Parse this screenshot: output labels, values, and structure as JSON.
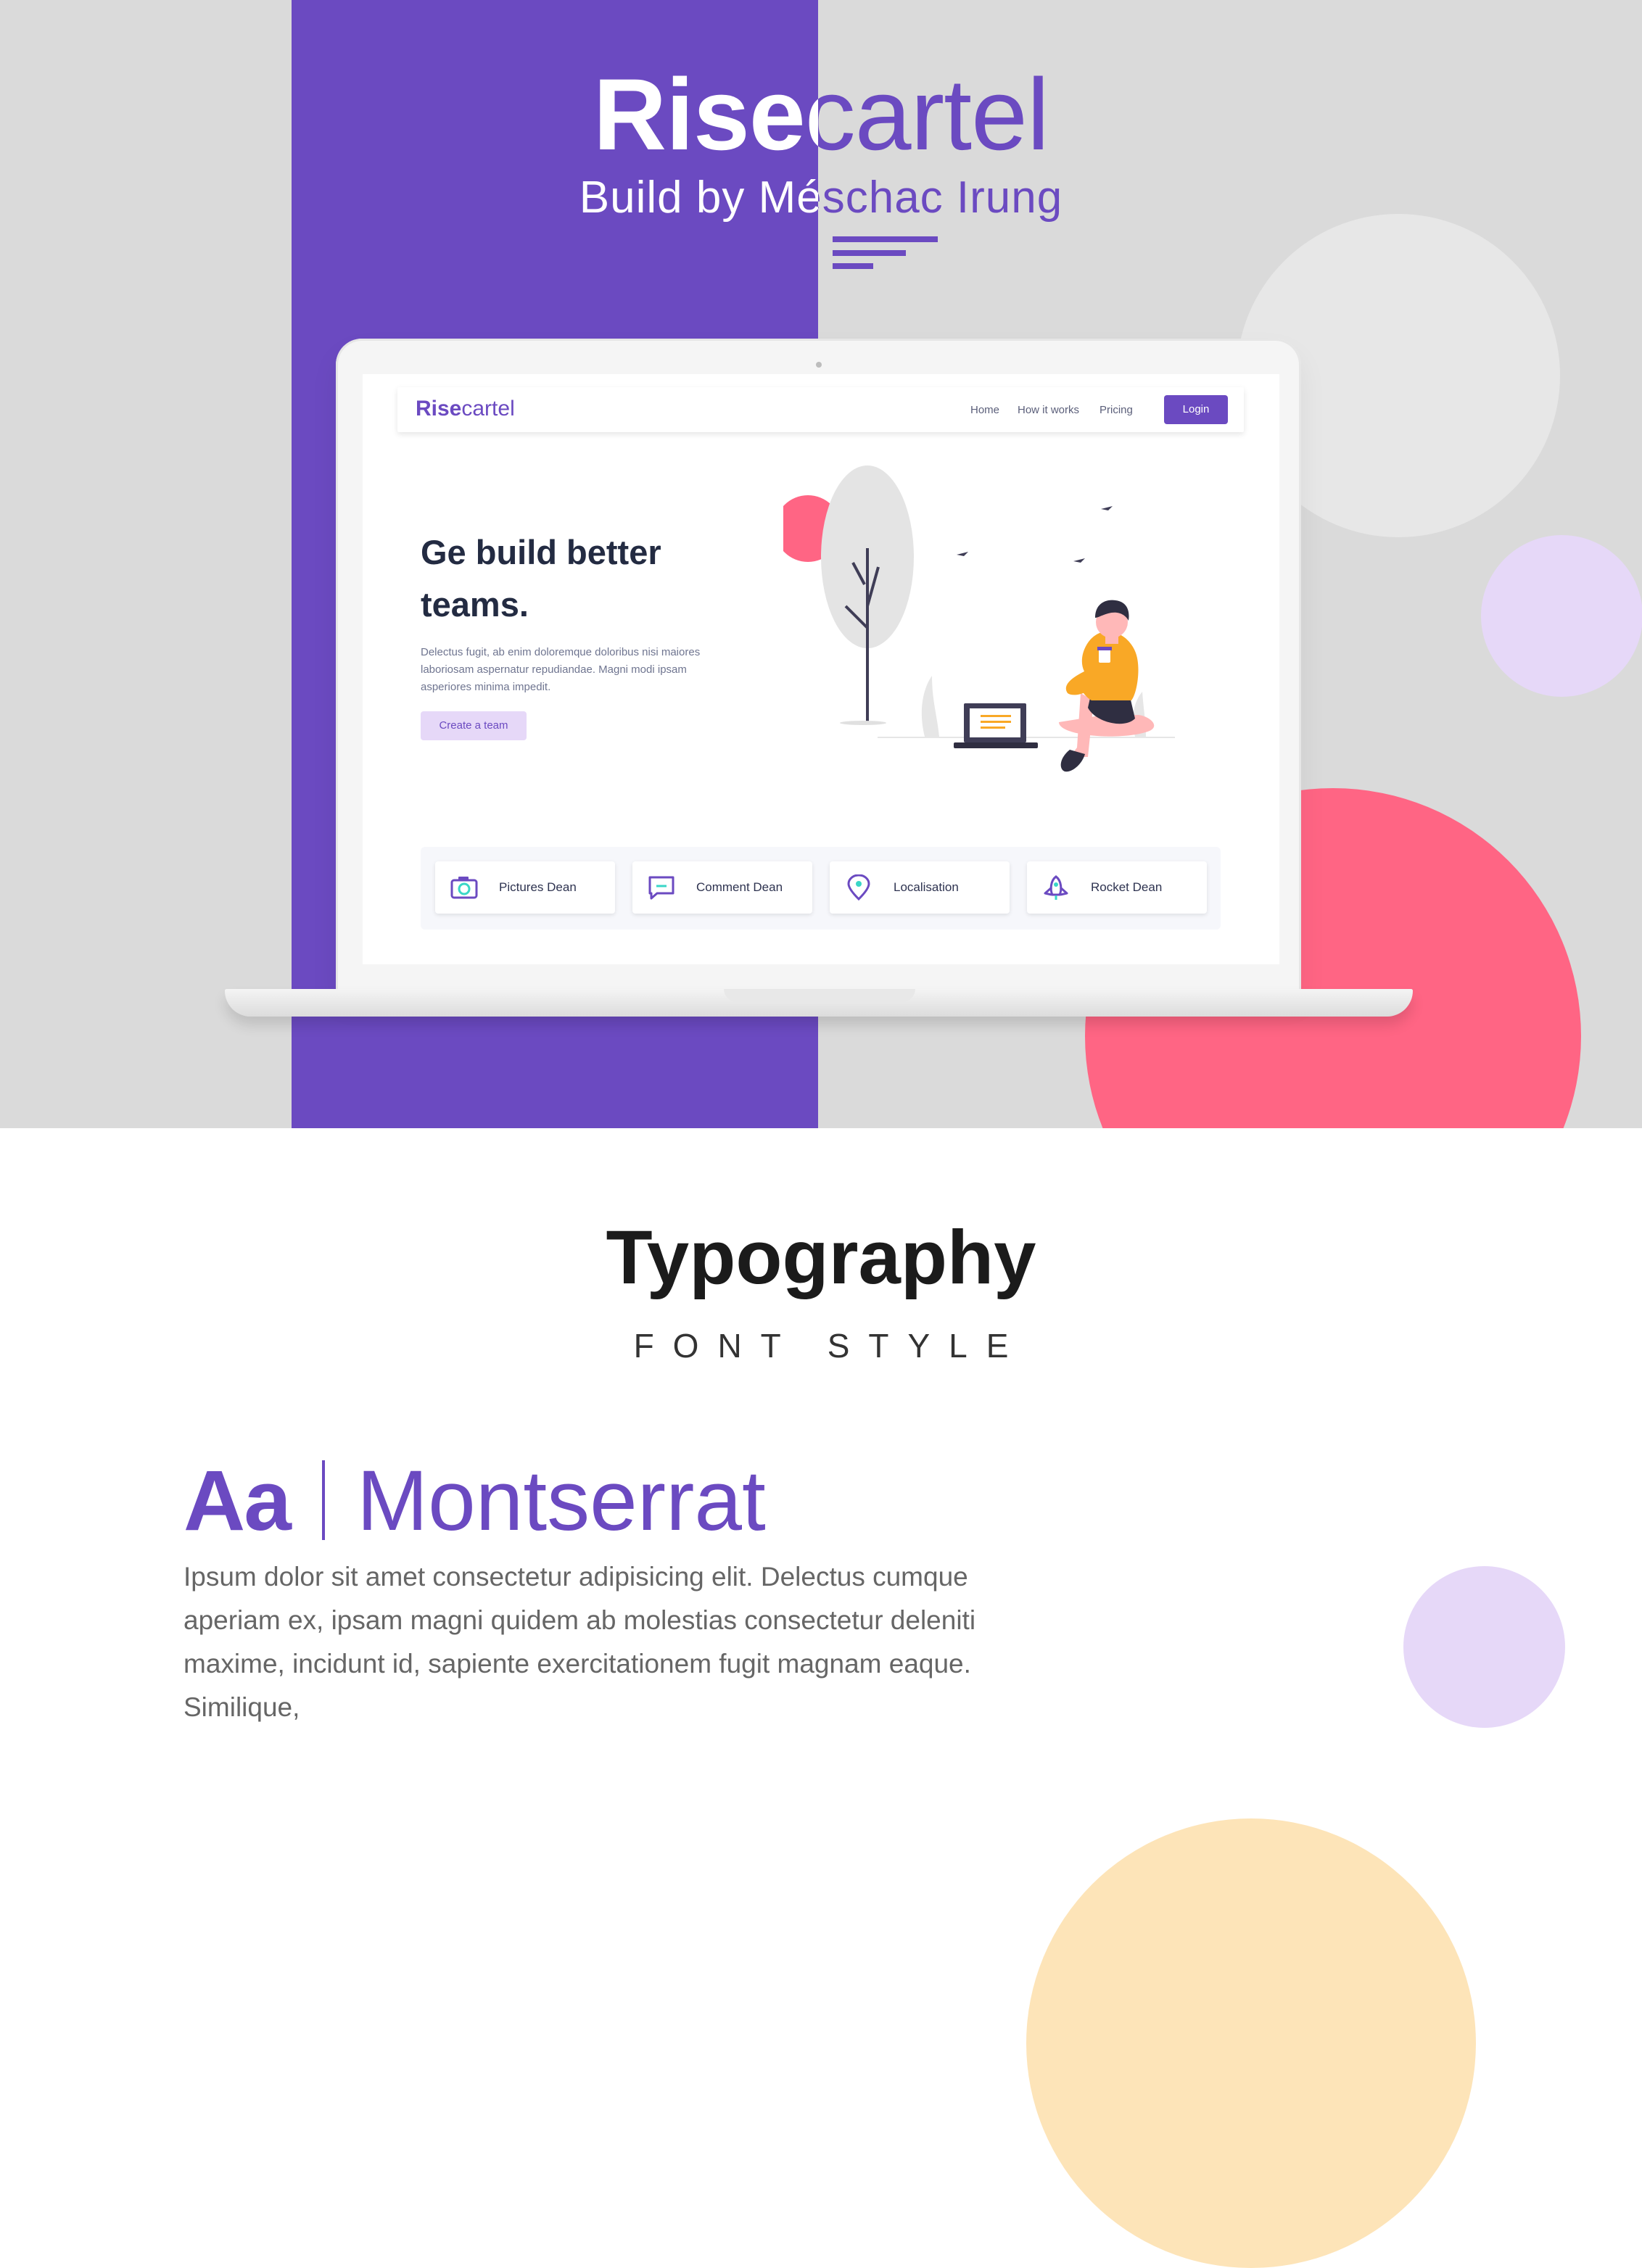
{
  "colors": {
    "brand_purple": "#6b4ac1",
    "band_grey": "#dadada",
    "accent_pink": "#ff6584",
    "lilac": "#e6d8f8",
    "peach": "#fde4b8",
    "illustration_yellow": "#f9a826"
  },
  "header": {
    "brand_bold": "Rise",
    "brand_light": "cartel",
    "subtitle": "Build by Méschac Irung",
    "decor_icon": "hamburger-lines-icon"
  },
  "site": {
    "logo_bold": "Rise",
    "logo_light": "cartel",
    "nav": [
      "Home",
      "How it works",
      "Pricing"
    ],
    "login_label": "Login",
    "headline": "Ge build better teams.",
    "description": "Delectus fugit, ab enim doloremque doloribus nisi maiores laboriosam aspernatur repudiandae. Magni modi ipsam asperiores minima impedit.",
    "cta_label": "Create a team",
    "illustration": "person-with-laptop-illustration",
    "features": [
      {
        "label": "Pictures Dean",
        "icon": "camera-icon"
      },
      {
        "label": "Comment Dean",
        "icon": "comment-icon"
      },
      {
        "label": "Localisation",
        "icon": "location-pin-icon"
      },
      {
        "label": "Rocket Dean",
        "icon": "rocket-icon"
      }
    ]
  },
  "typography": {
    "title": "Typography",
    "subtitle": "FONT STYLE",
    "sample_aa": "Aa",
    "font_name": "Montserrat",
    "body": "Ipsum dolor sit amet consectetur adipisicing elit. Delectus cumque aperiam ex, ipsam magni quidem ab molestias consectetur deleniti maxime, incidunt id, sapiente exercitationem fugit magnam eaque. Similique,"
  }
}
